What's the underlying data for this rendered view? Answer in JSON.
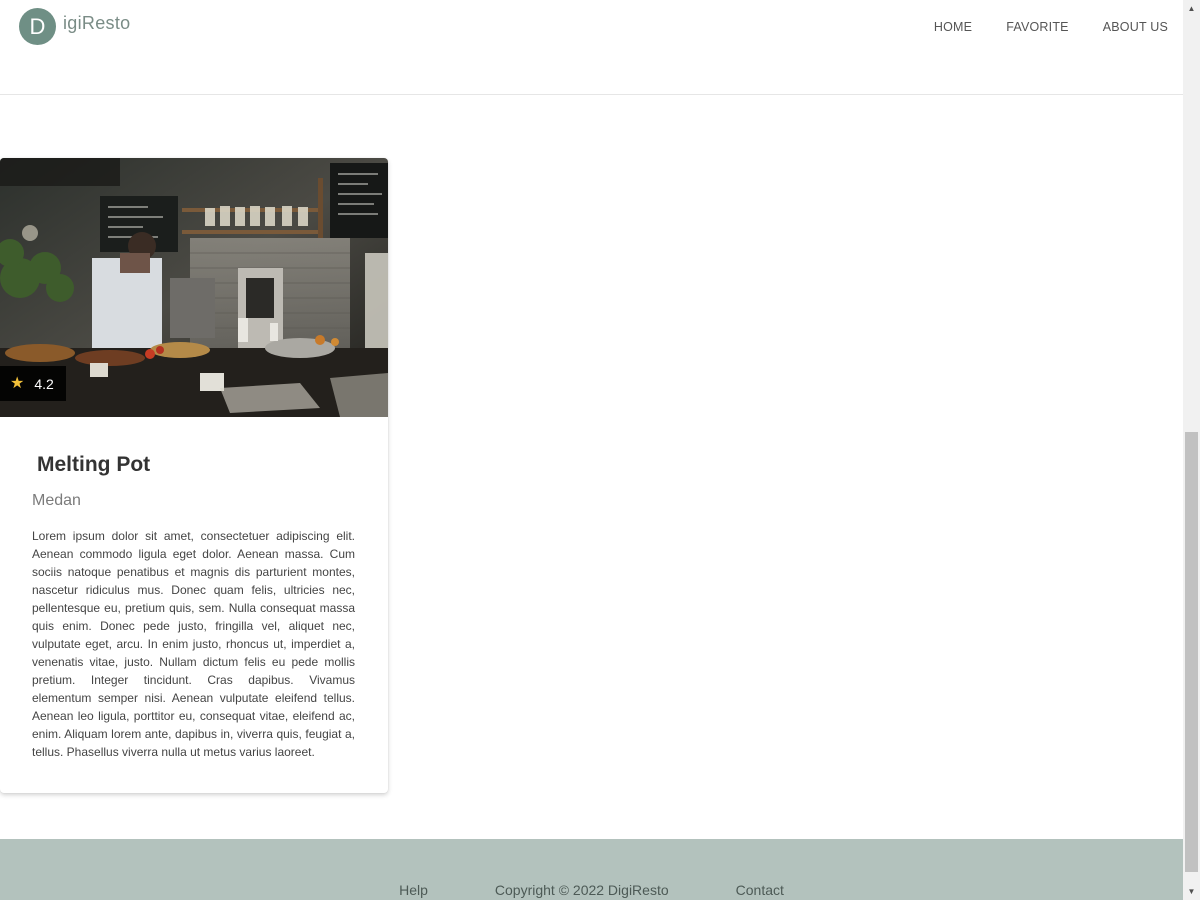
{
  "header": {
    "brand_initial": "D",
    "brand_rest": "igiResto",
    "nav": [
      {
        "label": "HOME"
      },
      {
        "label": "FAVORITE"
      },
      {
        "label": "ABOUT US"
      }
    ]
  },
  "card": {
    "rating_icon": "star-icon",
    "rating": "4.2",
    "title": "Melting Pot",
    "city": "Medan",
    "description": "Lorem ipsum dolor sit amet, consectetuer adipiscing elit. Aenean commodo ligula eget dolor. Aenean massa. Cum sociis natoque penatibus et magnis dis parturient montes, nascetur ridiculus mus. Donec quam felis, ultricies nec, pellentesque eu, pretium quis, sem. Nulla consequat massa quis enim. Donec pede justo, fringilla vel, aliquet nec, vulputate eget, arcu. In enim justo, rhoncus ut, imperdiet a, venenatis vitae, justo. Nullam dictum felis eu pede mollis pretium. Integer tincidunt. Cras dapibus. Vivamus elementum semper nisi. Aenean vulputate eleifend tellus. Aenean leo ligula, porttitor eu, consequat vitae, eleifend ac, enim. Aliquam lorem ante, dapibus in, viverra quis, feugiat a, tellus. Phasellus viverra nulla ut metus varius laoreet."
  },
  "footer": {
    "help": "Help",
    "copyright": "Copyright © 2022 DigiResto",
    "contact": "Contact"
  },
  "colors": {
    "brand_badge": "#6f8f85",
    "footer_bg": "#b3c2bd",
    "star": "#f3c13a"
  }
}
